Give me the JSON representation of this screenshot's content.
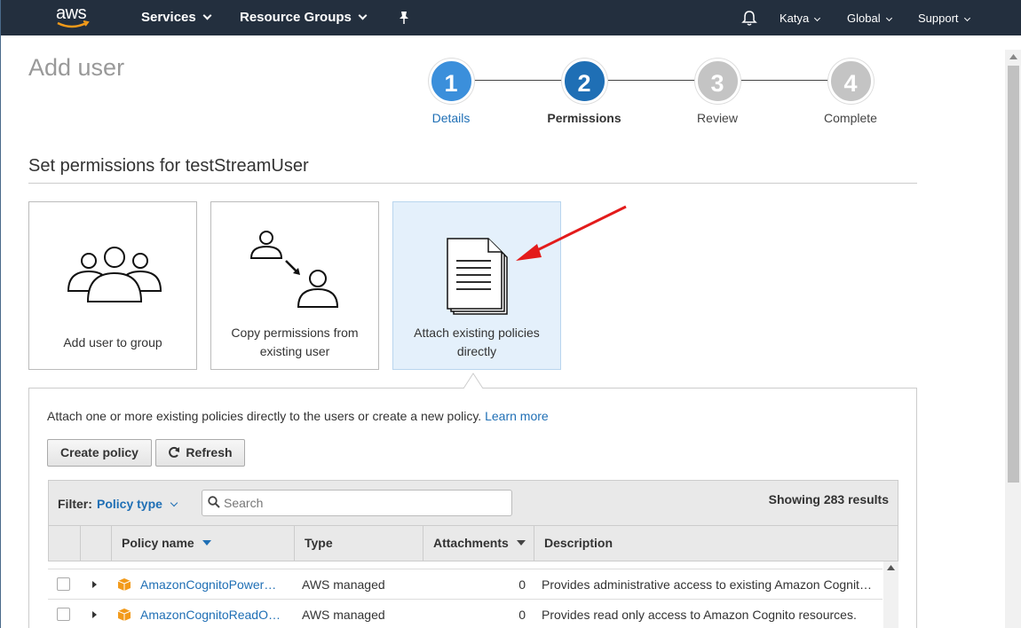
{
  "nav": {
    "logo": "aws",
    "services": "Services",
    "resource_groups": "Resource Groups",
    "user": "Katya",
    "region": "Global",
    "support": "Support"
  },
  "page": {
    "title": "Add user",
    "section_title": "Set permissions for testStreamUser"
  },
  "steps": [
    {
      "num": "1",
      "label": "Details",
      "state": "done"
    },
    {
      "num": "2",
      "label": "Permissions",
      "state": "active"
    },
    {
      "num": "3",
      "label": "Review",
      "state": "pending"
    },
    {
      "num": "4",
      "label": "Complete",
      "state": "pending"
    }
  ],
  "options": [
    {
      "label": "Add user to group",
      "icon": "group-icon"
    },
    {
      "label": "Copy permissions from existing user",
      "icon": "copy-user-icon"
    },
    {
      "label": "Attach existing policies directly",
      "icon": "document-icon",
      "selected": true
    }
  ],
  "panel": {
    "description": "Attach one or more existing policies directly to the users or create a new policy.",
    "learn_more": "Learn more",
    "create_policy": "Create policy",
    "refresh": "Refresh"
  },
  "filter": {
    "label": "Filter:",
    "value": "Policy type",
    "search_placeholder": "Search",
    "results": "Showing 283 results"
  },
  "table": {
    "columns": [
      "Policy name",
      "Type",
      "Attachments",
      "Description"
    ],
    "rows": [
      {
        "name": "AmazonCognitoPowerUser",
        "type": "AWS managed",
        "attachments": "0",
        "description": "Provides administrative access to existing Amazon Cognito resources."
      },
      {
        "name": "AmazonCognitoReadOnly",
        "type": "AWS managed",
        "attachments": "0",
        "description": "Provides read only access to Amazon Cognito resources."
      }
    ]
  },
  "colors": {
    "nav_bg": "#232f3e",
    "step_done": "#3b8fdb",
    "step_active": "#1f6fb5",
    "step_pending": "#c4c4c4",
    "link": "#1f6fb5",
    "selected_card": "#e4f0fb",
    "annotation_arrow": "#e31b1b",
    "policy_icon": "#f29a1a"
  }
}
